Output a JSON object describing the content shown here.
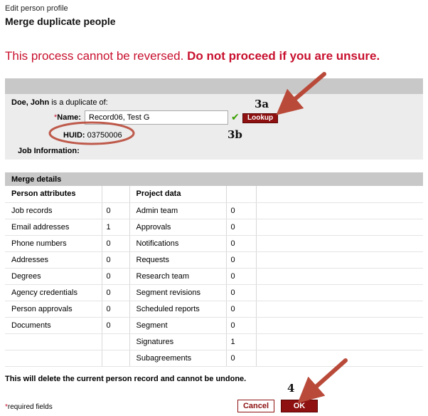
{
  "header": {
    "breadcrumb": "Edit person profile",
    "title": "Merge duplicate people"
  },
  "warning": {
    "part1": "This process cannot be reversed. ",
    "part2": "Do not proceed if you are unsure."
  },
  "duplicate": {
    "person_name": "Doe, John",
    "caption_suffix": " is a duplicate of:",
    "name_required_mark": "*",
    "name_label": "Name:",
    "name_value": "Record06, Test G",
    "lookup_label": "Lookup",
    "huid_label": "HUID:",
    "huid_value": "03750006",
    "job_info_label": "Job Information:"
  },
  "annotations": {
    "a3a": "3a",
    "a3b": "3b",
    "a4": "4",
    "arrow_color": "#b94a3a"
  },
  "merge": {
    "title": "Merge details",
    "person_header": "Person attributes",
    "project_header": "Project data",
    "rows": [
      {
        "pa": "Job records",
        "pv": "0",
        "pd": "Admin team",
        "dv": "0"
      },
      {
        "pa": "Email addresses",
        "pv": "1",
        "pd": "Approvals",
        "dv": "0"
      },
      {
        "pa": "Phone numbers",
        "pv": "0",
        "pd": "Notifications",
        "dv": "0"
      },
      {
        "pa": "Addresses",
        "pv": "0",
        "pd": "Requests",
        "dv": "0"
      },
      {
        "pa": "Degrees",
        "pv": "0",
        "pd": "Research team",
        "dv": "0"
      },
      {
        "pa": "Agency credentials",
        "pv": "0",
        "pd": "Segment revisions",
        "dv": "0"
      },
      {
        "pa": "Person approvals",
        "pv": "0",
        "pd": "Scheduled reports",
        "dv": "0"
      },
      {
        "pa": "Documents",
        "pv": "0",
        "pd": "Segment",
        "dv": "0"
      },
      {
        "pa": "",
        "pv": "",
        "pd": "Signatures",
        "dv": "1"
      },
      {
        "pa": "",
        "pv": "",
        "pd": "Subagreements",
        "dv": "0"
      }
    ]
  },
  "footer": {
    "delete_note": "This will delete the current person record and cannot be undone.",
    "required_mark": "*",
    "required_text": "required fields",
    "cancel_label": "Cancel",
    "ok_label": "OK"
  },
  "colors": {
    "accent": "#8e1010",
    "warning": "#c8102e",
    "check": "#3aa000"
  }
}
